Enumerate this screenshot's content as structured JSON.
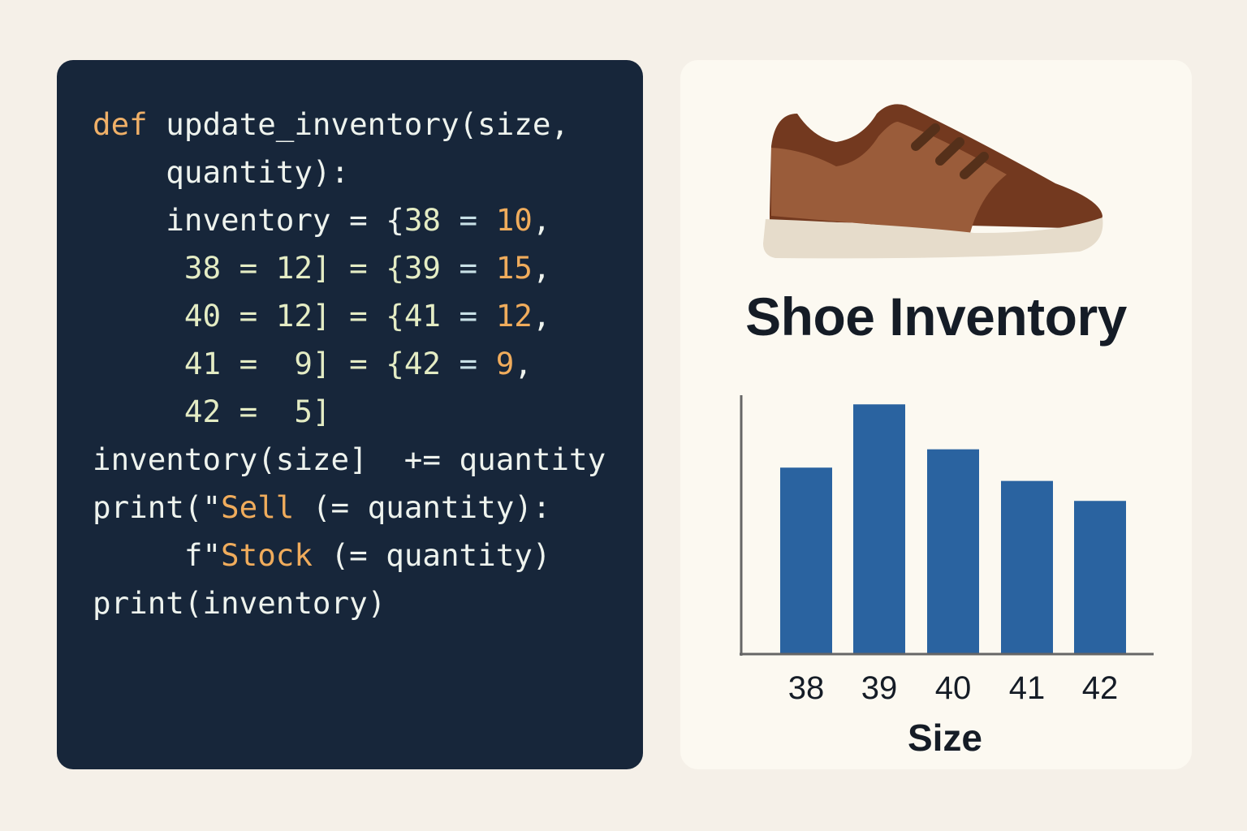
{
  "colors": {
    "page_bg": "#f5f0e8",
    "code_bg": "#17263a",
    "keyword": "#f0b068",
    "text": "#eef3ee",
    "number": "#e4ecc4",
    "value": "#f0ac5c",
    "string": "#f0ac5c",
    "operator": "#c8e0e6",
    "bar": "#2a63a0"
  },
  "code": {
    "lines": [
      [
        {
          "t": "def",
          "c": "keyword"
        },
        {
          "t": " update_inventory(size,",
          "c": "text"
        }
      ],
      [
        {
          "t": "    quantity):",
          "c": "text"
        }
      ],
      [
        {
          "t": "    inventory = {",
          "c": "text"
        },
        {
          "t": "38",
          "c": "number"
        },
        {
          "t": " = ",
          "c": "operator"
        },
        {
          "t": "10",
          "c": "value"
        },
        {
          "t": ",",
          "c": "text"
        }
      ],
      [
        {
          "t": "     38 = 12] = {",
          "c": "number"
        },
        {
          "t": "39",
          "c": "number"
        },
        {
          "t": " = ",
          "c": "operator"
        },
        {
          "t": "15",
          "c": "value"
        },
        {
          "t": ",",
          "c": "text"
        }
      ],
      [
        {
          "t": "     40 = 12] = {",
          "c": "number"
        },
        {
          "t": "41",
          "c": "number"
        },
        {
          "t": " = ",
          "c": "operator"
        },
        {
          "t": "12",
          "c": "value"
        },
        {
          "t": ",",
          "c": "text"
        }
      ],
      [
        {
          "t": "     41 =  9] = {",
          "c": "number"
        },
        {
          "t": "42",
          "c": "number"
        },
        {
          "t": " = ",
          "c": "operator"
        },
        {
          "t": "9",
          "c": "value"
        },
        {
          "t": ",",
          "c": "text"
        }
      ],
      [
        {
          "t": "     42 =  5]",
          "c": "number"
        }
      ],
      [
        {
          "t": "inventory(size]  += quantity",
          "c": "text"
        }
      ],
      [
        {
          "t": "print(\"",
          "c": "text"
        },
        {
          "t": "Sell",
          "c": "string"
        },
        {
          "t": " (= quantity):",
          "c": "text"
        }
      ],
      [
        {
          "t": "     f\"",
          "c": "text"
        },
        {
          "t": "Stock",
          "c": "string"
        },
        {
          "t": " (= quantity)",
          "c": "text"
        }
      ],
      [
        {
          "t": "print(inventory)",
          "c": "text"
        }
      ]
    ]
  },
  "card": {
    "title": "Shoe Inventory"
  },
  "chart_data": {
    "type": "bar",
    "title": "Shoe Inventory",
    "categories": [
      "38",
      "39",
      "40",
      "41",
      "42"
    ],
    "values": [
      11.2,
      15,
      12.3,
      10.4,
      9.2
    ],
    "xlabel": "Size",
    "ylabel": "",
    "ylim": [
      0,
      15.5
    ],
    "grid": false,
    "legend": "none"
  }
}
